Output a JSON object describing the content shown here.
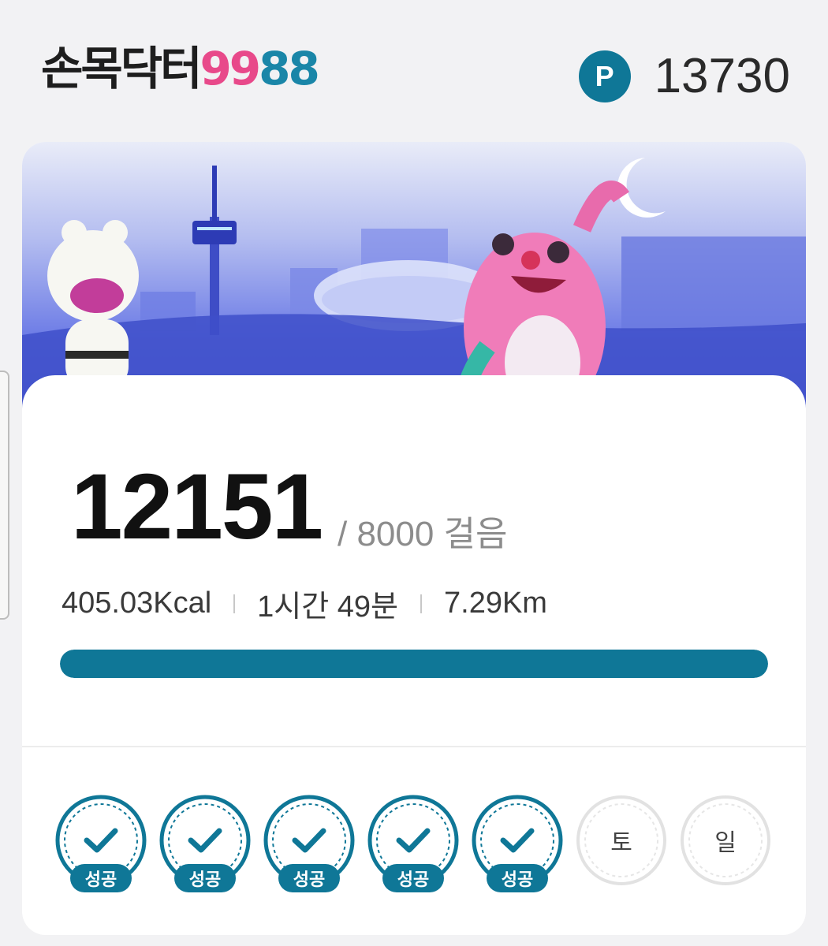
{
  "header": {
    "logo_korean": "손목닥터",
    "logo_num_a": "99",
    "logo_num_b": "88",
    "point_badge": "P",
    "points": "13730"
  },
  "steps": {
    "current": "12151",
    "goal_text": "/ 8000 걸음",
    "goal": 8000,
    "progress_fraction": 1.0
  },
  "stats": {
    "calories": "405.03Kcal",
    "duration": "1시간 49분",
    "distance": "7.29Km"
  },
  "week": {
    "days": [
      {
        "status": "success",
        "label": "성공"
      },
      {
        "status": "success",
        "label": "성공"
      },
      {
        "status": "success",
        "label": "성공"
      },
      {
        "status": "success",
        "label": "성공"
      },
      {
        "status": "success",
        "label": "성공"
      },
      {
        "status": "pending",
        "label": "토"
      },
      {
        "status": "pending",
        "label": "일"
      }
    ]
  },
  "colors": {
    "accent": "#0f7797",
    "logo_pink": "#e8498a",
    "logo_teal": "#1a86a8"
  }
}
